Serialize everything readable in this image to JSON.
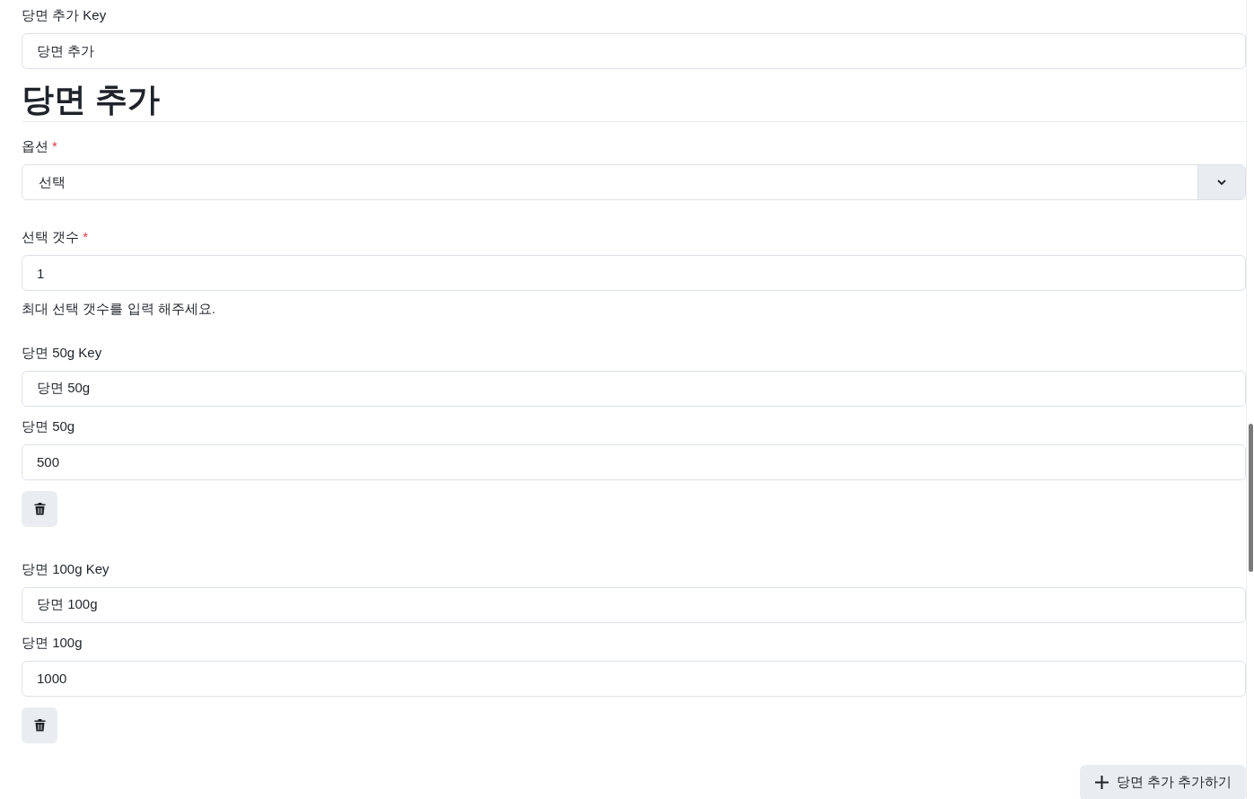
{
  "top_field": {
    "label": "당면 추가 Key",
    "value": "당면 추가"
  },
  "section": {
    "title": "당면 추가",
    "option": {
      "label": "옵션",
      "required_mark": "*",
      "value": "선택"
    },
    "count": {
      "label": "선택 갯수",
      "required_mark": "*",
      "value": "1",
      "help": "최대 선택 갯수를 입력 해주세요."
    },
    "items": [
      {
        "key_label": "당면 50g Key",
        "key_value": "당면 50g",
        "price_label": "당면 50g",
        "price_value": "500"
      },
      {
        "key_label": "당면 100g Key",
        "key_value": "당면 100g",
        "price_label": "당면 100g",
        "price_value": "1000"
      }
    ],
    "add_button": {
      "label": "당면 추가 추가하기"
    }
  }
}
